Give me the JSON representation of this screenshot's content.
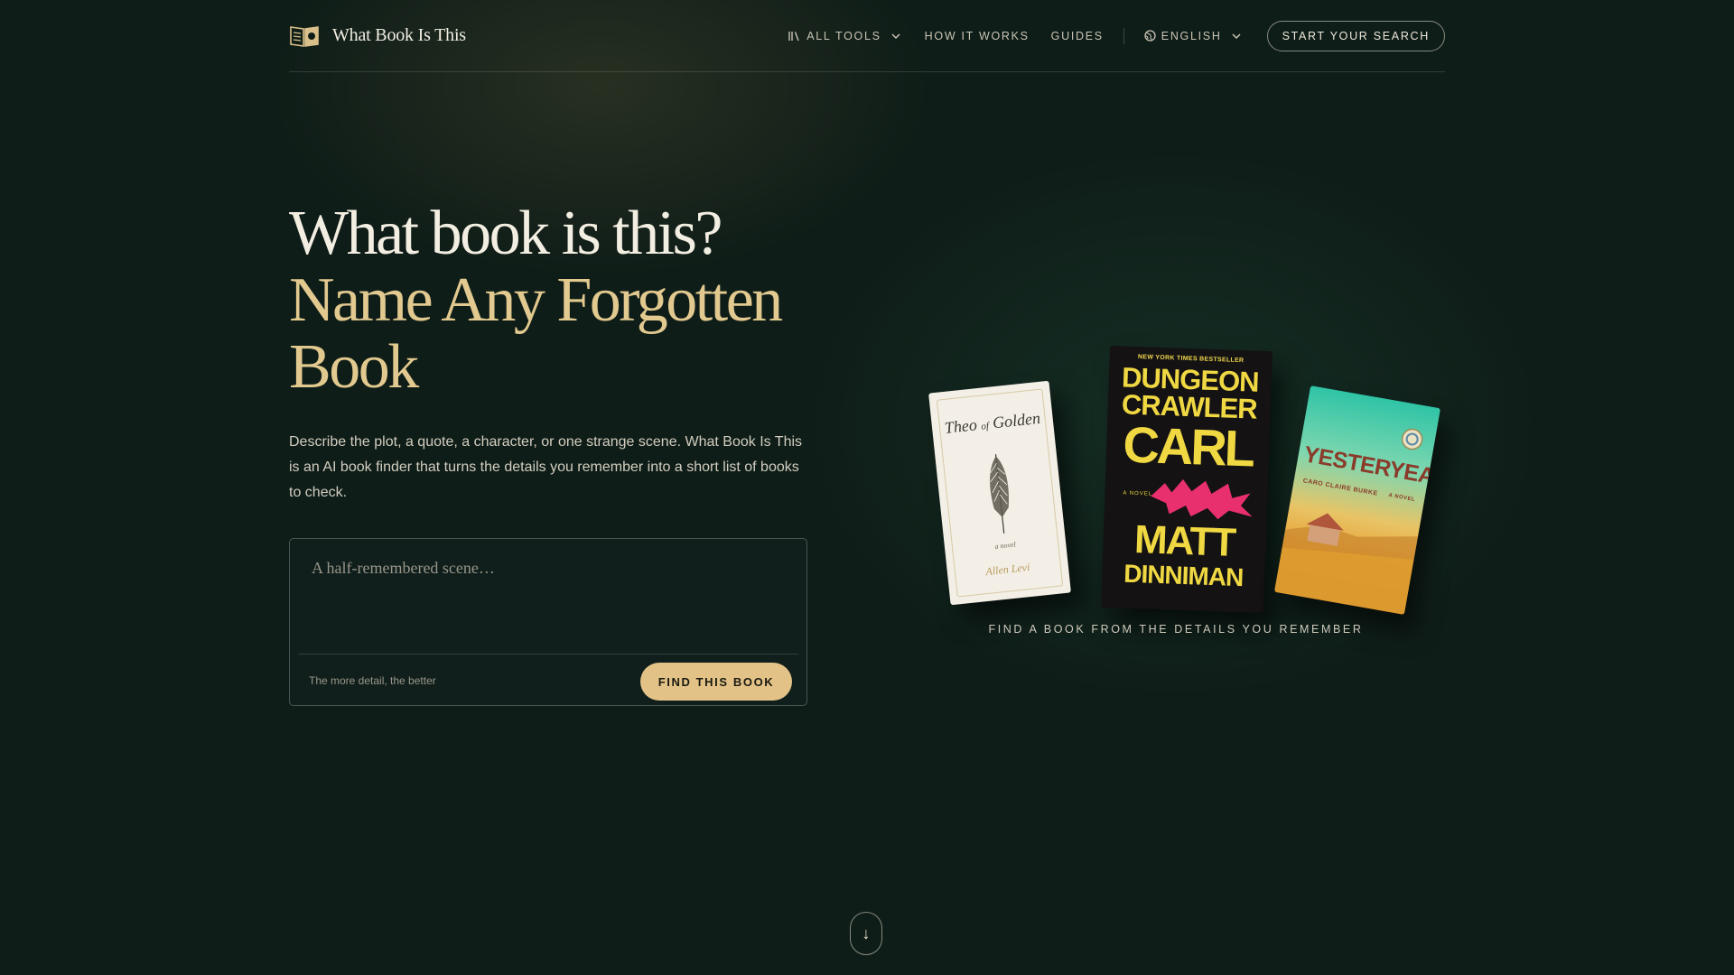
{
  "header": {
    "logo_text": "What Book Is This",
    "logo_icon": "open-book-icon",
    "nav": {
      "all_tools": "ALL TOOLS",
      "how_it_works": "HOW IT WORKS",
      "guides": "GUIDES",
      "language": "ENGLISH",
      "cta": "START YOUR SEARCH"
    }
  },
  "hero": {
    "title_line1": "What book is this?",
    "title_line2": "Name Any Forgotten Book",
    "description": "Describe the plot, a quote, a character, or one strange scene. What Book Is This is an AI book finder that turns the details you remember into a short list of books to check.",
    "search": {
      "placeholder": "A half-remembered scene…",
      "hint": "The more detail, the better",
      "button": "FIND THIS BOOK"
    }
  },
  "books": {
    "caption": "FIND A BOOK FROM THE DETAILS YOU REMEMBER",
    "items": [
      {
        "title": "Theo of Golden",
        "title_a": "Theo",
        "title_b": "of",
        "title_c": "Golden",
        "subtitle": "a novel",
        "author": "Allen Levi"
      },
      {
        "badge": "NEW YORK TIMES BESTSELLER",
        "title_1": "DUNGEON",
        "title_2": "CRAWLER",
        "title_3": "CARL",
        "label": "A NOVEL",
        "author_1": "MATT",
        "author_2": "DINNIMAN"
      },
      {
        "title": "YESTERYEAR",
        "author": "CARO CLAIRE BURKE",
        "label": "A NOVEL"
      }
    ]
  },
  "scroll": {
    "arrow": "↓"
  },
  "colors": {
    "background": "#0f1d18",
    "accent": "#e2c287",
    "title_gold": "#e2c98f"
  }
}
